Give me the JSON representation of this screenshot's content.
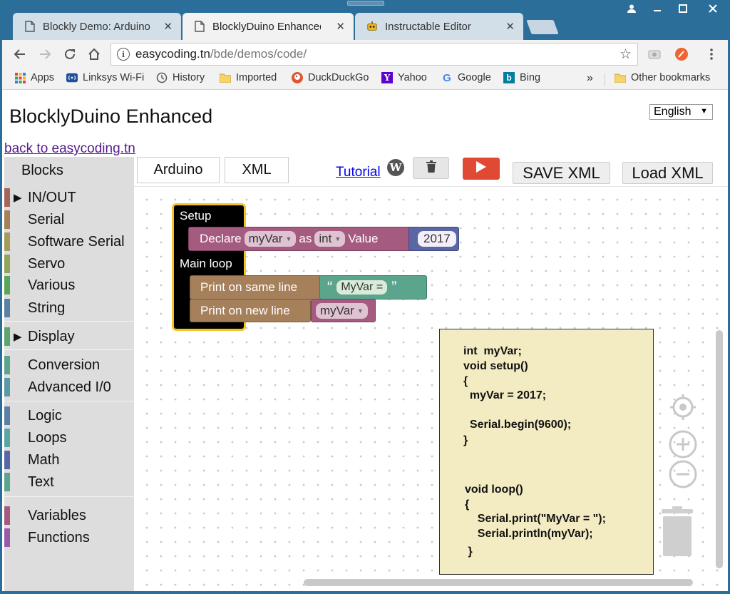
{
  "browser": {
    "tabs": [
      {
        "title": "Blockly Demo: Arduino",
        "icon": "page-icon",
        "active": false
      },
      {
        "title": "BlocklyDuino Enhanced C",
        "icon": "page-icon",
        "active": true
      },
      {
        "title": "Instructable Editor",
        "icon": "instructables-robot-icon",
        "active": false
      }
    ],
    "close_glyph": "✕",
    "url_host": "easycoding.tn",
    "url_path": "/bde/demos/code/",
    "bookmarks": [
      {
        "label": "Apps",
        "icon": "apps-grid-icon"
      },
      {
        "label": "Linksys Wi-Fi",
        "icon": "linksys-icon"
      },
      {
        "label": "History",
        "icon": "history-icon"
      },
      {
        "label": "Imported",
        "icon": "folder-icon"
      },
      {
        "label": "DuckDuckGo",
        "icon": "duckduckgo-icon"
      },
      {
        "label": "Yahoo",
        "icon": "yahoo-icon"
      },
      {
        "label": "Google",
        "icon": "google-icon"
      },
      {
        "label": "Bing",
        "icon": "bing-icon"
      }
    ],
    "more_bookmarks": "»",
    "other_bookmarks": "Other bookmarks"
  },
  "page": {
    "title": "BlocklyDuino Enhanced",
    "language": "English",
    "back_link": "back to easycoding.tn",
    "tabs": {
      "arduino": "Arduino",
      "xml": "XML"
    },
    "tutorial": "Tutorial",
    "save_xml": "SAVE XML",
    "load_xml": "Load XML"
  },
  "sidebar": {
    "heading": "Blocks",
    "categories": [
      {
        "label": "IN/OUT",
        "color": "#a5655b",
        "expandable": true
      },
      {
        "label": "Serial",
        "color": "#a5805b"
      },
      {
        "label": "Software Serial",
        "color": "#a59b5b"
      },
      {
        "label": "Servo",
        "color": "#90a55b"
      },
      {
        "label": "Various",
        "color": "#5ba55b"
      },
      {
        "label": "String",
        "color": "#5b80a5"
      },
      {
        "label": "Display",
        "color": "#5ba56e",
        "expandable": true
      },
      {
        "label": "Conversion",
        "color": "#5ba58c"
      },
      {
        "label": "Advanced I/0",
        "color": "#5b99a5"
      },
      {
        "label": "Logic",
        "color": "#5b80a5"
      },
      {
        "label": "Loops",
        "color": "#5ba5a5"
      },
      {
        "label": "Math",
        "color": "#5b67a5"
      },
      {
        "label": "Text",
        "color": "#5ba58c"
      },
      {
        "label": "Variables",
        "color": "#a55b80"
      },
      {
        "label": "Functions",
        "color": "#995ba5"
      }
    ]
  },
  "blocks": {
    "setup": "Setup",
    "declare": "Declare",
    "var_name": "myVar",
    "as": "as",
    "type": "int",
    "value": "Value",
    "number": "2017",
    "main_loop": "Main loop",
    "print_same_line": "Print on same line",
    "string_value": "MyVar =",
    "print_new_line": "Print on new line",
    "open_quote": "“",
    "close_quote": "”"
  },
  "code": [
    "int  myVar;",
    "void setup()",
    "{",
    "  myVar = 2017;",
    "",
    "  Serial.begin(9600);",
    "}",
    "",
    "",
    "void loop()",
    "{",
    "    Serial.print(\"MyVar = \");",
    "    Serial.println(myVar);",
    " }"
  ],
  "colors": {
    "frame": "#2c6e9a",
    "variables_block": "#a55b80",
    "serial_block": "#a5805b",
    "text_block": "#5ba58c",
    "math_block": "#5b67a5",
    "setup_border": "#f5c326"
  }
}
